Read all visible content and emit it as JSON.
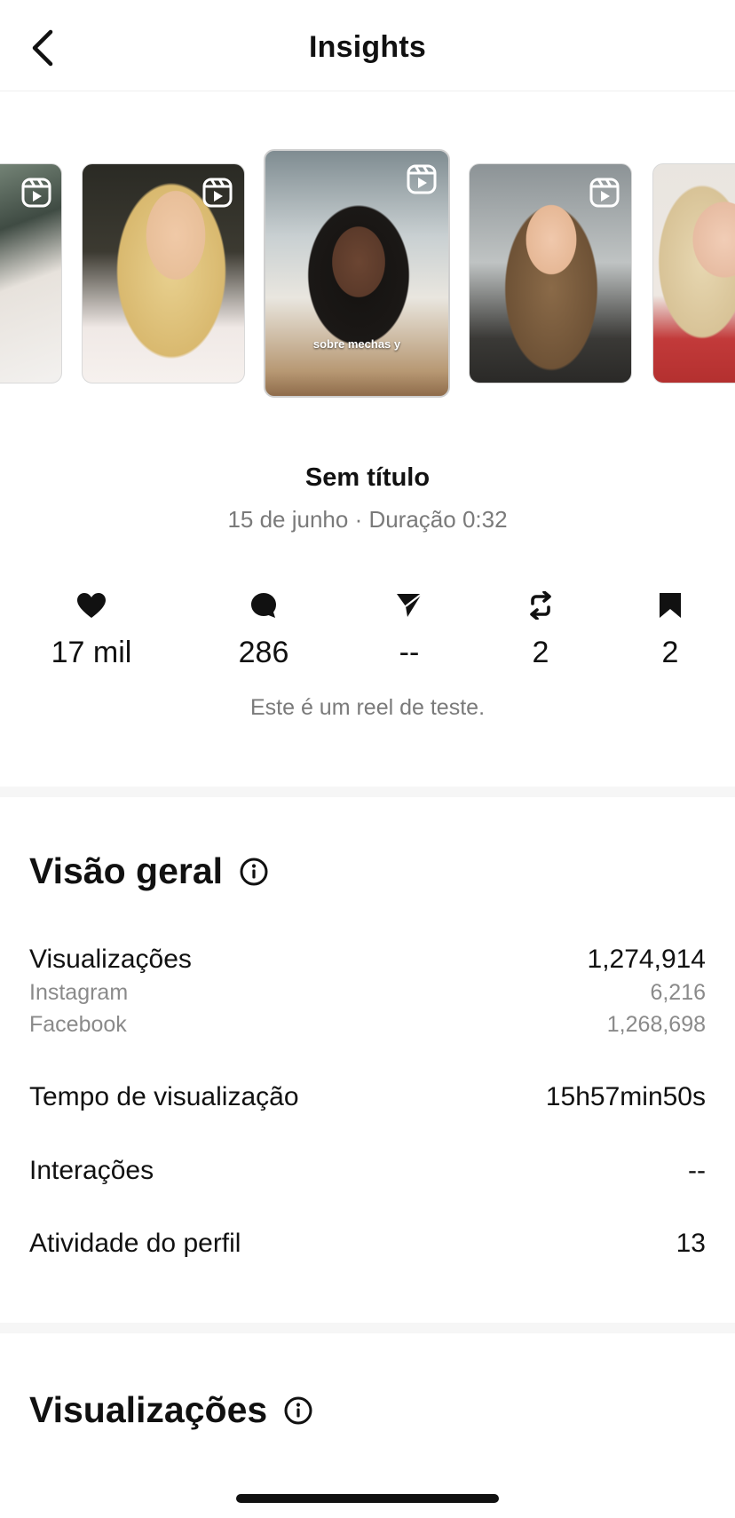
{
  "header": {
    "title": "Insights"
  },
  "carousel": {
    "items": [
      {
        "caption": ""
      },
      {
        "caption": ""
      },
      {
        "caption": "sobre mechas y"
      },
      {
        "caption": ""
      },
      {
        "caption": ""
      }
    ]
  },
  "post": {
    "title": "Sem título",
    "meta": "15 de junho · Duração 0:32",
    "description": "Este é um reel de teste."
  },
  "stats": {
    "likes": "17 mil",
    "comments": "286",
    "shares": "--",
    "reposts": "2",
    "saves": "2"
  },
  "overview": {
    "title": "Visão geral",
    "views_label": "Visualizações",
    "views_value": "1,274,914",
    "instagram_label": "Instagram",
    "instagram_value": "6,216",
    "facebook_label": "Facebook",
    "facebook_value": "1,268,698",
    "watch_time_label": "Tempo de visualização",
    "watch_time_value": "15h57min50s",
    "interactions_label": "Interações",
    "interactions_value": "--",
    "profile_activity_label": "Atividade do perfil",
    "profile_activity_value": "13"
  },
  "views_section": {
    "title": "Visualizações"
  },
  "icons": {
    "back": "chevron-left-icon",
    "info": "info-circle-icon",
    "reel": "reel-icon",
    "like": "heart-icon",
    "comment": "comment-bubble-icon",
    "share": "paper-plane-icon",
    "repost": "repost-icon",
    "save": "bookmark-icon"
  }
}
